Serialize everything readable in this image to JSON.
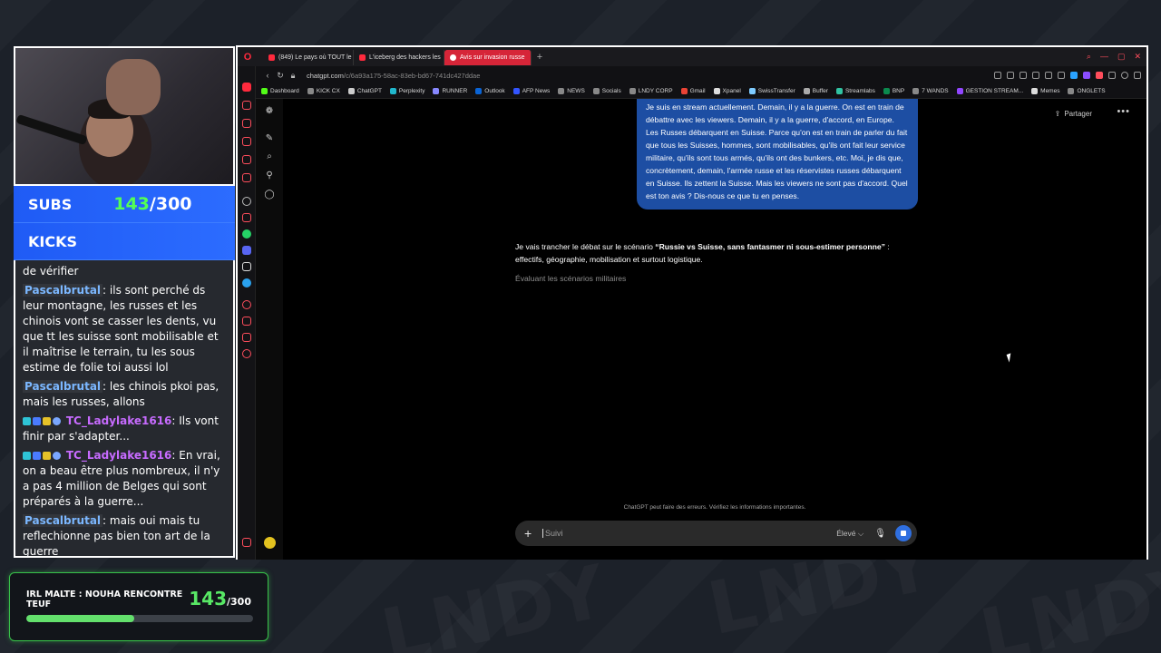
{
  "stream": {
    "goals": [
      {
        "label": "SUBS",
        "current": "143",
        "max": "/300"
      },
      {
        "label": "KICKS"
      }
    ],
    "chat": [
      {
        "user": "",
        "text": "de vérifier"
      },
      {
        "user": "Pascalbrutal",
        "text": ": ils sont perché ds leur montagne, les russes et les chinois vont se casser les dents, vu que tt les suisse sont mobilisable et il maîtrise le terrain, tu les sous estime de folie toi aussi lol"
      },
      {
        "user": "Pascalbrutal",
        "text": ": les chinois pkoi pas, mais les russes, allons"
      },
      {
        "user": "TC_Ladylake1616",
        "text": ": Ils vont finir par s'adapter..."
      },
      {
        "user": "TC_Ladylake1616",
        "text": ": En vrai, on a beau être plus nombreux, il n'y a pas 4 million de Belges qui sont préparés à la guerre..."
      },
      {
        "user": "Pascalbrutal",
        "text": ": mais oui mais tu reflechionne pas bien ton art de la guerre"
      }
    ],
    "bottom_goal": {
      "title": "IRL MALTE : NOUHA RENCONTRE TEUF",
      "current": "143",
      "max": "/300",
      "progress_fraction": 0.477
    }
  },
  "browser": {
    "tabs": [
      {
        "label": "(849) Le pays où TOUT le"
      },
      {
        "label": "L'iceberg des hackers les"
      },
      {
        "label": "Avis sur invasion russe",
        "active": true
      }
    ],
    "new_tab": "+",
    "url_host": "chatgpt.com",
    "url_path": "/c/6a93a175-58ac-83eb-bd67-741dc427ddae",
    "bookmarks": [
      {
        "label": "Dashboard",
        "color": "#53fc18"
      },
      {
        "label": "KICK CX",
        "color": "#888888"
      },
      {
        "label": "ChatGPT",
        "color": "#cccccc"
      },
      {
        "label": "Perplexity",
        "color": "#20b8cd"
      },
      {
        "label": "RUNNER",
        "color": "#8888ff"
      },
      {
        "label": "Outlook",
        "color": "#0a64d6"
      },
      {
        "label": "AFP News",
        "color": "#3355ff"
      },
      {
        "label": "NEWS",
        "color": "#888888"
      },
      {
        "label": "Socials",
        "color": "#888888"
      },
      {
        "label": "LNDY CORP",
        "color": "#888888"
      },
      {
        "label": "Gmail",
        "color": "#ea4335"
      },
      {
        "label": "Xpanel",
        "color": "#dddddd"
      },
      {
        "label": "SwissTransfer",
        "color": "#7ecbff"
      },
      {
        "label": "Buffer",
        "color": "#aaaaaa"
      },
      {
        "label": "Streamlabs",
        "color": "#31c3a2"
      },
      {
        "label": "BNP",
        "color": "#0b8a4e"
      },
      {
        "label": "7 WANDS",
        "color": "#888888"
      },
      {
        "label": "GESTION STREAM...",
        "color": "#9146ff"
      },
      {
        "label": "Memes",
        "color": "#dddddd"
      },
      {
        "label": "ONGLETS",
        "color": "#888888"
      }
    ]
  },
  "chatgpt": {
    "share_label": "Partager",
    "more_label": "•••",
    "user_message": "Je suis en stream actuellement. Demain, il y a la guerre. On est en train de débattre avec les viewers. Demain, il y a la guerre, d'accord, en Europe. Les Russes débarquent en Suisse. Parce qu'on est en train de parler du fait que tous les Suisses, hommes, sont mobilisables, qu'ils ont fait leur service militaire, qu'ils sont tous armés, qu'ils ont des bunkers, etc. Moi, je dis que, concrètement, demain, l'armée russe et les réservistes russes débarquent en Suisse. Ils zettent la Suisse. Mais les viewers ne sont pas d'accord. Quel est ton avis ? Dis-nous ce que tu en penses.",
    "assistant_intro": "Je vais trancher le débat sur le scénario ",
    "assistant_bold": "“Russie vs Suisse, sans fantasmer ni sous-estimer personne”",
    "assistant_rest": " : effectifs, géographie, mobilisation et surtout logistique.",
    "thinking": "Évaluant les scénarios militaires",
    "disclaimer": "ChatGPT peut faire des erreurs. Vérifiez les informations importantes.",
    "composer_placeholder": "Suivi",
    "model_label": "Élevé ⌵"
  }
}
